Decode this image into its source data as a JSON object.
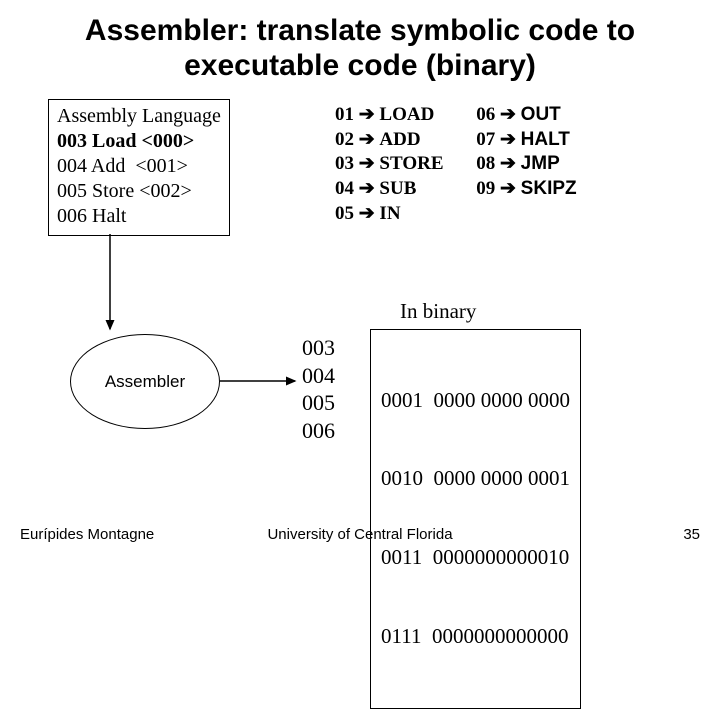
{
  "title": "Assembler: translate symbolic code to executable code (binary)",
  "asm": {
    "heading": "Assembly Language",
    "rows": [
      {
        "addr": "003",
        "instr": "Load",
        "arg": "<000>",
        "bold": true
      },
      {
        "addr": "004",
        "instr": "Add",
        "arg": " <001>",
        "bold": false
      },
      {
        "addr": "005",
        "instr": "Store",
        "arg": "<002>",
        "bold": false
      },
      {
        "addr": "006",
        "instr": "Halt",
        "arg": "",
        "bold": false
      }
    ]
  },
  "opcodes": {
    "col1": [
      {
        "code": "01",
        "mn": "LOAD"
      },
      {
        "code": "02",
        "mn": "ADD"
      },
      {
        "code": "03",
        "mn": "STORE"
      },
      {
        "code": "04",
        "mn": "SUB"
      },
      {
        "code": "05",
        "mn": "IN"
      }
    ],
    "col2": [
      {
        "code": "06",
        "mn": "OUT"
      },
      {
        "code": "07",
        "mn": "HALT"
      },
      {
        "code": "08",
        "mn": "JMP"
      },
      {
        "code": "09",
        "mn": "SKIPZ"
      }
    ]
  },
  "assembler_label": "Assembler",
  "binary": {
    "label": "In binary",
    "rows": [
      {
        "addr": "003",
        "bits": "0001  0000 0000 0000"
      },
      {
        "addr": "004",
        "bits": "0010  0000 0000 0001"
      },
      {
        "addr": "005",
        "bits": "0011  0000000000010"
      },
      {
        "addr": "006",
        "bits": "0111  0000000000000"
      }
    ]
  },
  "footer": {
    "author": "Eurípides Montagne",
    "org": "University of Central Florida",
    "page": "35"
  },
  "arrow": "➔"
}
